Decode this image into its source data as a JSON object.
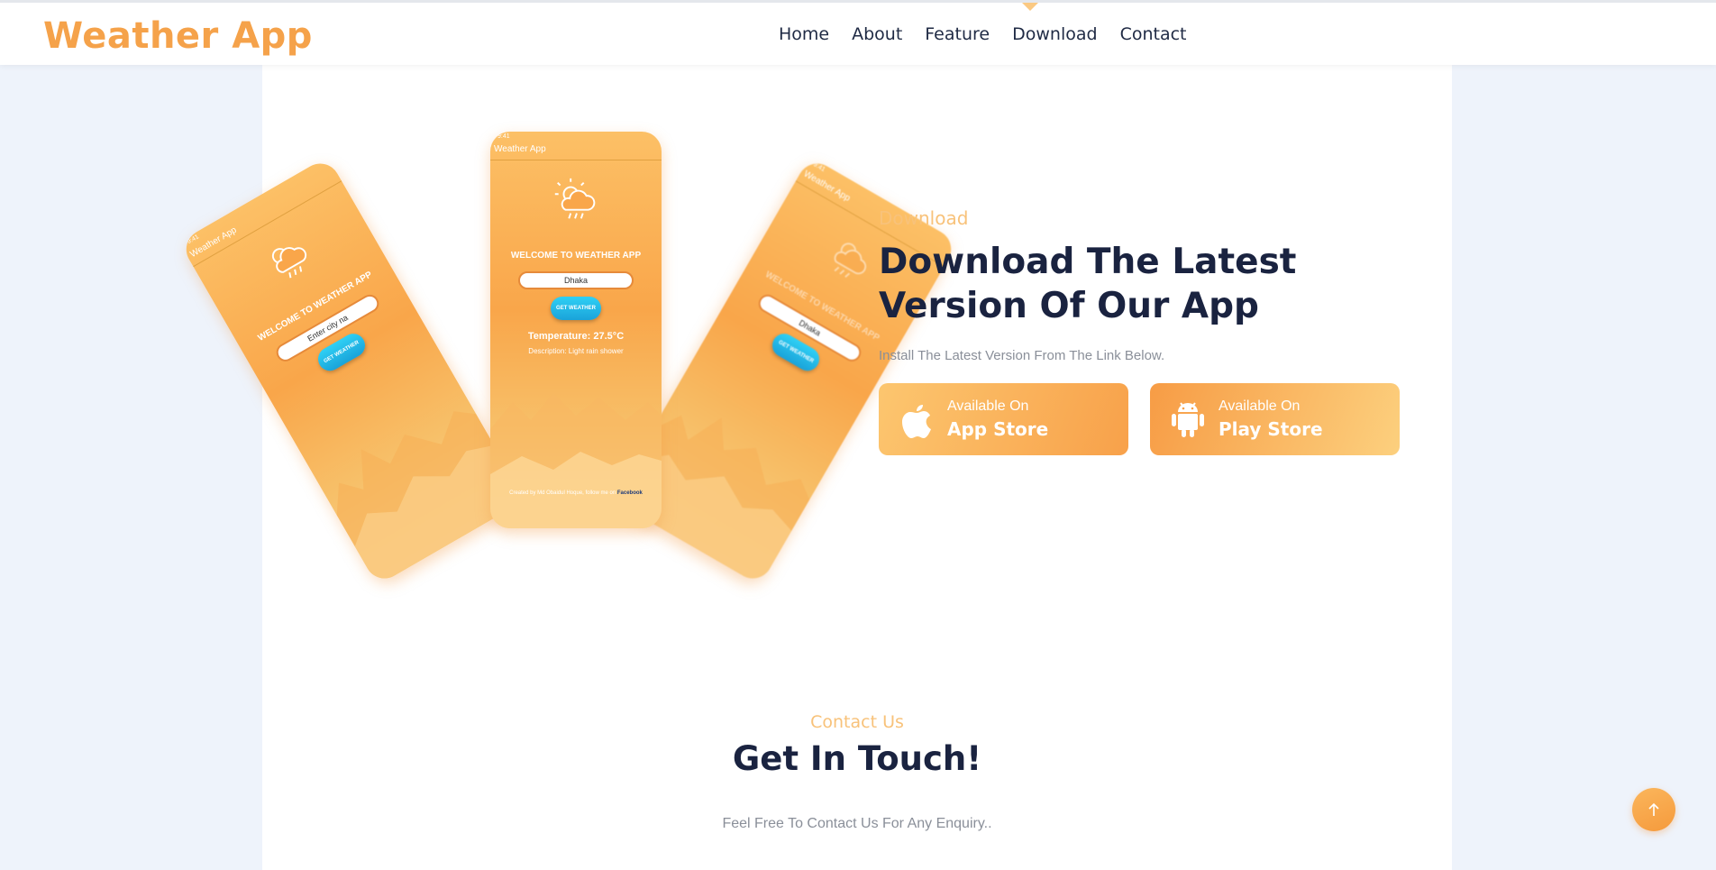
{
  "header": {
    "brand": "Weather App",
    "nav": [
      "Home",
      "About",
      "Feature",
      "Download",
      "Contact"
    ],
    "active_nav": "Download"
  },
  "phone_mockup": {
    "status_time": "9:41",
    "app_title": "Weather App",
    "welcome": "WELCOME TO WEATHER APP",
    "city": "Dhaka",
    "button": "GET WEATHER",
    "temperature": "Temperature: 27.5°C",
    "description": "Description: Light rain shower",
    "credit_prefix": "Created by Md Obaidul Hoque, follow me on",
    "credit_link": "Facebook"
  },
  "download": {
    "kicker": "Download",
    "title": "Download The Latest Version Of Our App",
    "subtitle": "Install The Latest Version From The Link Below.",
    "stores": [
      {
        "small": "Available On",
        "big": "App Store",
        "icon": "apple-icon"
      },
      {
        "small": "Available On",
        "big": "Play Store",
        "icon": "android-icon"
      }
    ]
  },
  "contact": {
    "kicker": "Contact Us",
    "title": "Get In Touch!",
    "subtitle": "Feel Free To Contact Us For Any Enquiry.."
  },
  "colors": {
    "accent": "#f5a24a",
    "heading": "#1a2340",
    "page_bg": "#eef3fb"
  }
}
